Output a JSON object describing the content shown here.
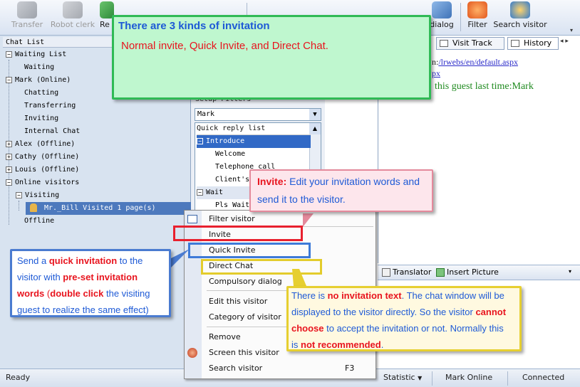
{
  "toolbar": {
    "buttons": [
      {
        "label": "Transfer",
        "icon": "transfer-icon",
        "enabled": false
      },
      {
        "label": "Robot clerk",
        "icon": "robot-icon",
        "enabled": false
      },
      {
        "label": "Re",
        "icon": "refresh-icon",
        "enabled": true
      },
      {
        "label": "dialog",
        "icon": "dialog-icon",
        "enabled": true
      },
      {
        "label": "Filter",
        "icon": "filter-icon",
        "enabled": true
      },
      {
        "label": "Search visitor",
        "icon": "search-visitor-icon",
        "enabled": true
      }
    ]
  },
  "chat_list": {
    "header": "Chat List",
    "rows": [
      {
        "text": "Waiting List",
        "expander": "−"
      },
      {
        "text": "Waiting"
      },
      {
        "text": "Mark (Online)",
        "expander": "−"
      },
      {
        "text": "Chatting"
      },
      {
        "text": "Transferring"
      },
      {
        "text": "Inviting"
      },
      {
        "text": "Internal Chat"
      },
      {
        "text": "Alex (Offline)",
        "expander": "+"
      },
      {
        "text": "Cathy (Offline)",
        "expander": "+"
      },
      {
        "text": "Louis (Offline)",
        "expander": "+"
      },
      {
        "text": "Online visitors",
        "expander": "−"
      },
      {
        "text": "Visiting",
        "expander": "−"
      },
      {
        "text": "Mr._Bill Visited 1 page(s)"
      },
      {
        "text": "Offline"
      }
    ]
  },
  "middle": {
    "setup_filters_label": "Setup Filters",
    "operator_select": "Mark",
    "quick_reply_header": "Quick reply list",
    "items": [
      "Introduce",
      "Welcome",
      "Telephone call",
      "Client's",
      "Wait",
      "Pls Wait"
    ]
  },
  "right": {
    "tabs": [
      "Visit Track",
      "History"
    ],
    "url_line_prefix": "n:",
    "url_link": "/lrwebs/en/default.aspx",
    "url_line2": "px",
    "last_time_text": "this guest last time:Mark",
    "edit_bar": {
      "translator": "Translator",
      "insert_picture": "Insert Picture"
    }
  },
  "context_menu": {
    "items": [
      "Filter visitor",
      "Invite",
      "Quick Invite",
      "Direct Chat",
      "Compulsory dialog",
      "Edit this visitor",
      "Category of visitor",
      "Remove",
      "Screen this visitor",
      "Search visitor"
    ],
    "search_shortcut": "F3"
  },
  "status_bar": {
    "ready": "Ready",
    "statistic": "Statistic",
    "operator": "Mark Online",
    "connection": "Connected"
  },
  "callouts": {
    "kinds": {
      "title": "There are 3 kinds of invitation",
      "body": "Normal invite,  Quick Invite,  and Direct Chat."
    },
    "invite": {
      "lead": "Invite:",
      "line1": " Edit your invitation words and",
      "line2": "send it to the visitor."
    },
    "quick": {
      "t1": "Send a ",
      "t2": "quick invitation",
      "t3": " to the",
      "t4": "visitor with ",
      "t5": "pre-set invitation",
      "t6": "words",
      "t7": " (",
      "t8": "double click",
      "t9": " the visiting",
      "t10": "guest to realize the same effect)"
    },
    "direct": {
      "t1": "There is ",
      "t2": "no invitation text",
      "t3": ". The chat window will be",
      "t4": "displayed to the visitor directly. So the visitor ",
      "t5": "cannot",
      "t6": "choose",
      "t7": " to accept the invitation or not. Normally this",
      "t8": "is ",
      "t9": "not recommended",
      "t10": "."
    }
  },
  "colors": {
    "accent_red": "#e8141e",
    "accent_blue": "#1e5ad6",
    "callout_green_border": "#2fba55",
    "menu_invite_box": "#e8202e",
    "menu_quick_box": "#3d7ad8",
    "menu_direct_box": "#e3cc2c"
  }
}
